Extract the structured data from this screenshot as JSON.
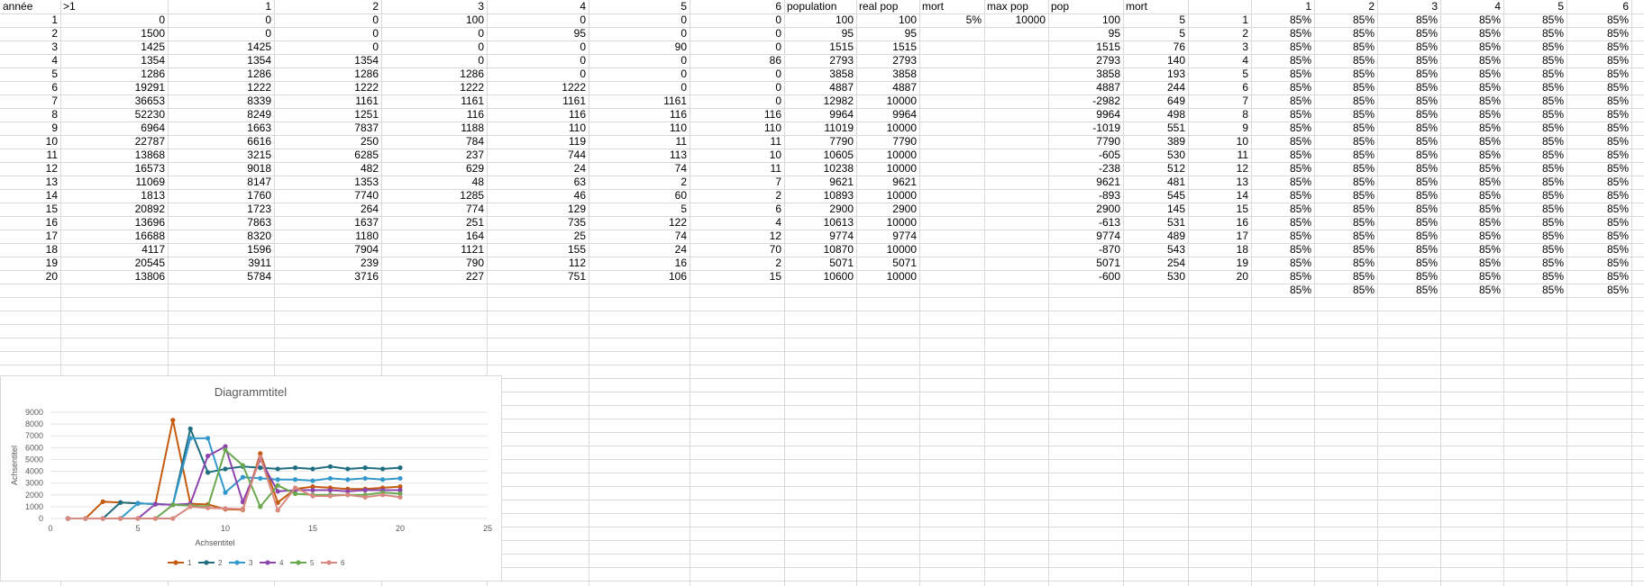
{
  "sheet": {
    "headers": {
      "annee": "année",
      "gt1": ">1",
      "c1": "1",
      "c2": "2",
      "c3": "3",
      "c4": "4",
      "c5": "5",
      "c6": "6",
      "population": "population",
      "real_pop": "real pop",
      "mort": "mort",
      "max_pop": "max pop",
      "pop": "pop",
      "mort2": "mort",
      "p1": "1",
      "p2": "2",
      "p3": "3",
      "p4": "4",
      "p5": "5",
      "p6": "6"
    },
    "mort_value": "5%",
    "max_pop_value": "10000",
    "mort2_header_value": "5",
    "rows": [
      [
        "1",
        "0",
        "0",
        "0",
        "100",
        "0",
        "0",
        "0",
        "100",
        "100",
        "100",
        "5",
        "1"
      ],
      [
        "2",
        "1500",
        "0",
        "0",
        "0",
        "95",
        "0",
        "0",
        "95",
        "95",
        "95",
        "5",
        "2"
      ],
      [
        "3",
        "1425",
        "1425",
        "0",
        "0",
        "0",
        "90",
        "0",
        "1515",
        "1515",
        "1515",
        "76",
        "3"
      ],
      [
        "4",
        "1354",
        "1354",
        "1354",
        "0",
        "0",
        "0",
        "86",
        "2793",
        "2793",
        "2793",
        "140",
        "4"
      ],
      [
        "5",
        "1286",
        "1286",
        "1286",
        "1286",
        "0",
        "0",
        "0",
        "3858",
        "3858",
        "3858",
        "193",
        "5"
      ],
      [
        "6",
        "19291",
        "1222",
        "1222",
        "1222",
        "1222",
        "0",
        "0",
        "4887",
        "4887",
        "4887",
        "244",
        "6"
      ],
      [
        "7",
        "36653",
        "8339",
        "1161",
        "1161",
        "1161",
        "1161",
        "0",
        "12982",
        "10000",
        "-2982",
        "649",
        "7"
      ],
      [
        "8",
        "52230",
        "8249",
        "1251",
        "116",
        "116",
        "116",
        "116",
        "9964",
        "9964",
        "9964",
        "498",
        "8"
      ],
      [
        "9",
        "6964",
        "1663",
        "7837",
        "1188",
        "110",
        "110",
        "110",
        "11019",
        "10000",
        "-1019",
        "551",
        "9"
      ],
      [
        "10",
        "22787",
        "6616",
        "250",
        "784",
        "119",
        "11",
        "11",
        "7790",
        "7790",
        "7790",
        "389",
        "10"
      ],
      [
        "11",
        "13868",
        "3215",
        "6285",
        "237",
        "744",
        "113",
        "10",
        "10605",
        "10000",
        "-605",
        "530",
        "11"
      ],
      [
        "12",
        "16573",
        "9018",
        "482",
        "629",
        "24",
        "74",
        "11",
        "10238",
        "10000",
        "-238",
        "512",
        "12"
      ],
      [
        "13",
        "11069",
        "8147",
        "1353",
        "48",
        "63",
        "2",
        "7",
        "9621",
        "9621",
        "9621",
        "481",
        "13"
      ],
      [
        "14",
        "1813",
        "1760",
        "7740",
        "1285",
        "46",
        "60",
        "2",
        "10893",
        "10000",
        "-893",
        "545",
        "14"
      ],
      [
        "15",
        "20892",
        "1723",
        "264",
        "774",
        "129",
        "5",
        "6",
        "2900",
        "2900",
        "2900",
        "145",
        "15"
      ],
      [
        "16",
        "13696",
        "7863",
        "1637",
        "251",
        "735",
        "122",
        "4",
        "10613",
        "10000",
        "-613",
        "531",
        "16"
      ],
      [
        "17",
        "16688",
        "8320",
        "1180",
        "164",
        "25",
        "74",
        "12",
        "9774",
        "9774",
        "9774",
        "489",
        "17"
      ],
      [
        "18",
        "4117",
        "1596",
        "7904",
        "1121",
        "155",
        "24",
        "70",
        "10870",
        "10000",
        "-870",
        "543",
        "18"
      ],
      [
        "19",
        "20545",
        "3911",
        "239",
        "790",
        "112",
        "16",
        "2",
        "5071",
        "5071",
        "5071",
        "254",
        "19"
      ],
      [
        "20",
        "13806",
        "5784",
        "3716",
        "227",
        "751",
        "106",
        "15",
        "10600",
        "10000",
        "-600",
        "530",
        "20"
      ]
    ],
    "percent_value": "85%",
    "percent_rows": 21
  },
  "chart_data": {
    "type": "scatter",
    "title": "Diagrammtitel",
    "xlabel": "Achsentitel",
    "ylabel": "Achsentitel",
    "xlim": [
      0,
      25
    ],
    "ylim": [
      0,
      9000
    ],
    "xticks": [
      "0",
      "5",
      "10",
      "15",
      "20",
      "25"
    ],
    "yticks": [
      "0",
      "1000",
      "2000",
      "3000",
      "4000",
      "5000",
      "6000",
      "7000",
      "8000",
      "9000"
    ],
    "legend_position": "bottom",
    "x": [
      1,
      2,
      3,
      4,
      5,
      6,
      7,
      8,
      9,
      10,
      11,
      12,
      13,
      14,
      15,
      16,
      17,
      18,
      19,
      20
    ],
    "series": [
      {
        "name": "1",
        "color": "#c55a11",
        "values": [
          0,
          0,
          1425,
          1354,
          1286,
          1222,
          8339,
          1251,
          1188,
          784,
          744,
          5500,
          1353,
          2500,
          2700,
          2600,
          2500,
          2500,
          2600,
          2700
        ]
      },
      {
        "name": "2",
        "color": "#1f6e80",
        "values": [
          0,
          0,
          0,
          1354,
          1286,
          1222,
          1161,
          7600,
          3900,
          4200,
          4400,
          4300,
          4200,
          4300,
          4200,
          4400,
          4200,
          4300,
          4200,
          4300
        ]
      },
      {
        "name": "3",
        "color": "#3399cc",
        "values": [
          0,
          0,
          0,
          0,
          1286,
          1222,
          1161,
          6800,
          6800,
          2200,
          3500,
          3400,
          3300,
          3300,
          3200,
          3400,
          3300,
          3400,
          3300,
          3400
        ]
      },
      {
        "name": "4",
        "color": "#8e44ad",
        "values": [
          0,
          0,
          0,
          0,
          0,
          1222,
          1161,
          1251,
          5300,
          6100,
          1400,
          5000,
          2300,
          2400,
          2400,
          2400,
          2300,
          2400,
          2400,
          2400
        ]
      },
      {
        "name": "5",
        "color": "#6aa84f",
        "values": [
          0,
          0,
          0,
          0,
          0,
          0,
          1161,
          1100,
          1000,
          5800,
          4500,
          1000,
          2800,
          2100,
          2000,
          2000,
          2000,
          2000,
          2200,
          2100
        ]
      },
      {
        "name": "6",
        "color": "#d98880",
        "values": [
          0,
          0,
          0,
          0,
          0,
          0,
          0,
          1000,
          900,
          850,
          800,
          5200,
          700,
          2600,
          1900,
          1900,
          2000,
          1800,
          2000,
          1800
        ]
      }
    ]
  }
}
